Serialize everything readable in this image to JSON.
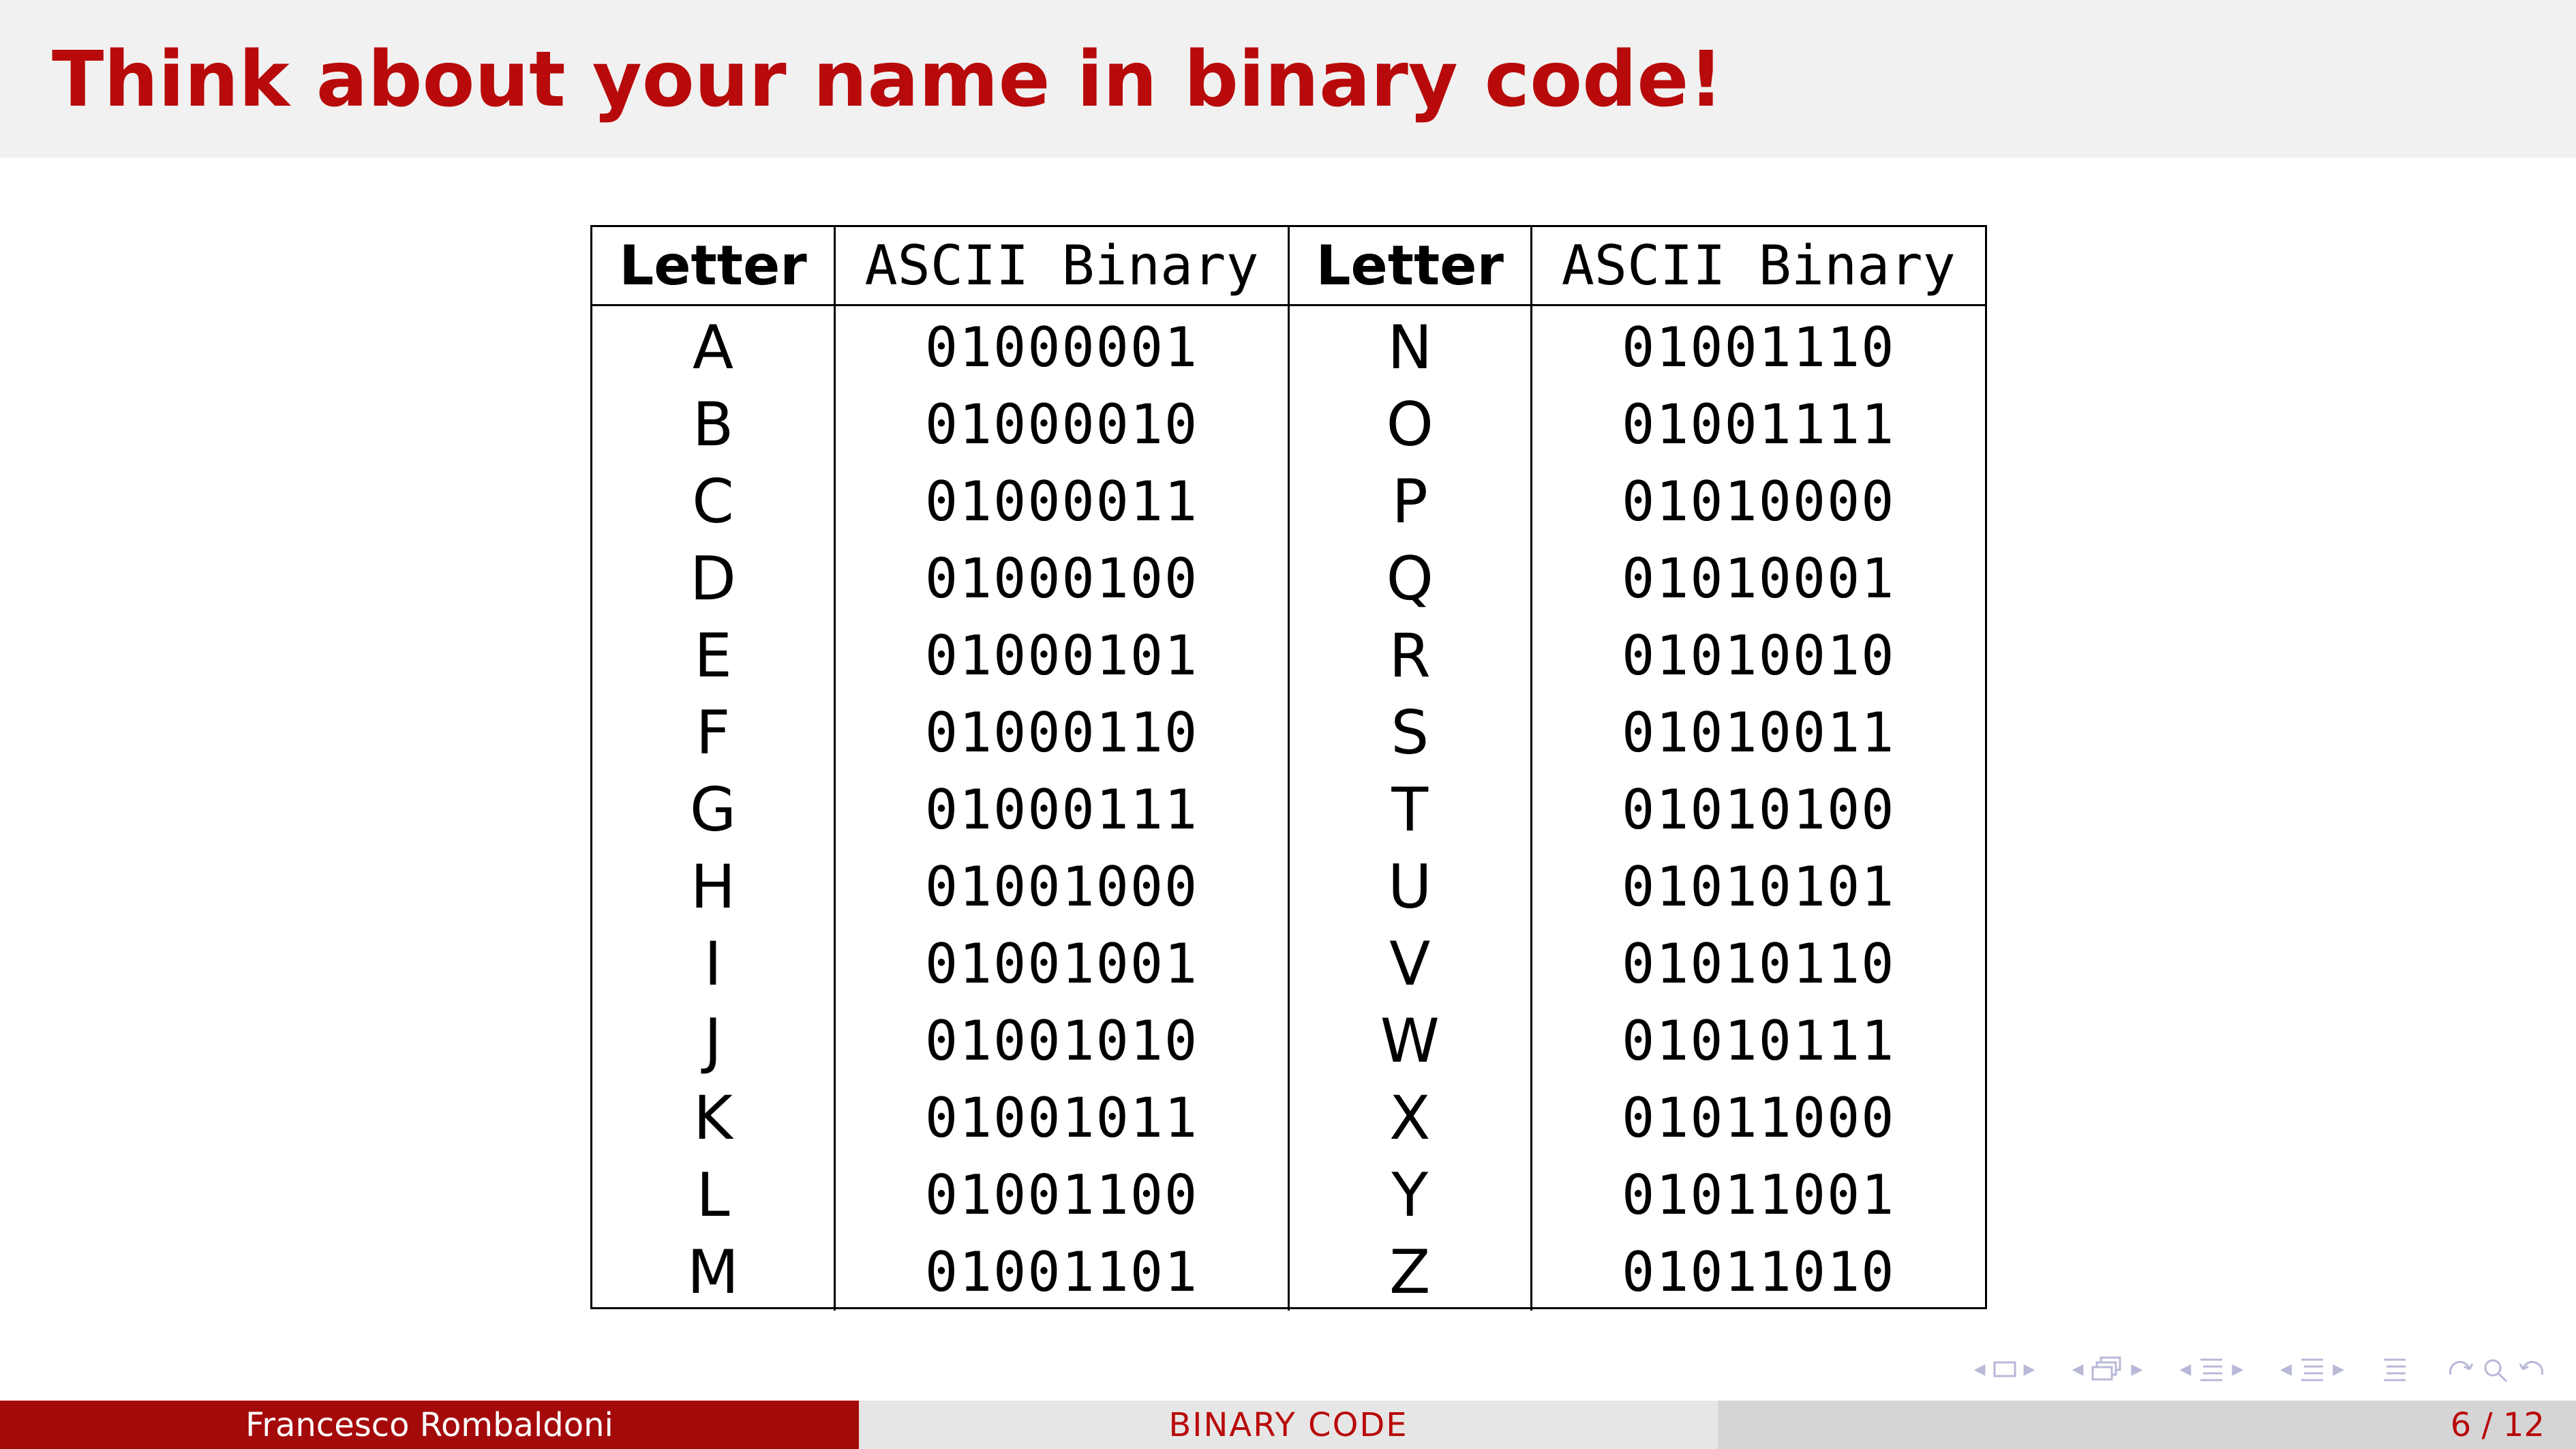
{
  "slide": {
    "title": "Think about your name in binary code!"
  },
  "table": {
    "headers": [
      "Letter",
      "ASCII Binary",
      "Letter",
      "ASCII Binary"
    ],
    "rows": [
      [
        "A",
        "01000001",
        "N",
        "01001110"
      ],
      [
        "B",
        "01000010",
        "O",
        "01001111"
      ],
      [
        "C",
        "01000011",
        "P",
        "01010000"
      ],
      [
        "D",
        "01000100",
        "Q",
        "01010001"
      ],
      [
        "E",
        "01000101",
        "R",
        "01010010"
      ],
      [
        "F",
        "01000110",
        "S",
        "01010011"
      ],
      [
        "G",
        "01000111",
        "T",
        "01010100"
      ],
      [
        "H",
        "01001000",
        "U",
        "01010101"
      ],
      [
        "I",
        "01001001",
        "V",
        "01010110"
      ],
      [
        "J",
        "01001010",
        "W",
        "01010111"
      ],
      [
        "K",
        "01001011",
        "X",
        "01011000"
      ],
      [
        "L",
        "01001100",
        "Y",
        "01011001"
      ],
      [
        "M",
        "01001101",
        "Z",
        "01011010"
      ]
    ]
  },
  "footer": {
    "author": "Francesco Rombaldoni",
    "short_title": "BINARY CODE",
    "page": "6 / 12"
  },
  "navigation": {
    "icons": [
      "frame-nav-icon",
      "subsection-nav-icon",
      "section-nav-icon",
      "slide-nav-icon",
      "document-nav-icon",
      "search-icon"
    ]
  },
  "colors": {
    "title": "#b80a0a",
    "title_bar_bg": "#f1f1f1",
    "footer_left_bg": "#a50a0a",
    "footer_mid_bg": "#e6e6e6",
    "footer_right_bg": "#d5d5d5",
    "nav_icons": "#b8b8d8"
  }
}
